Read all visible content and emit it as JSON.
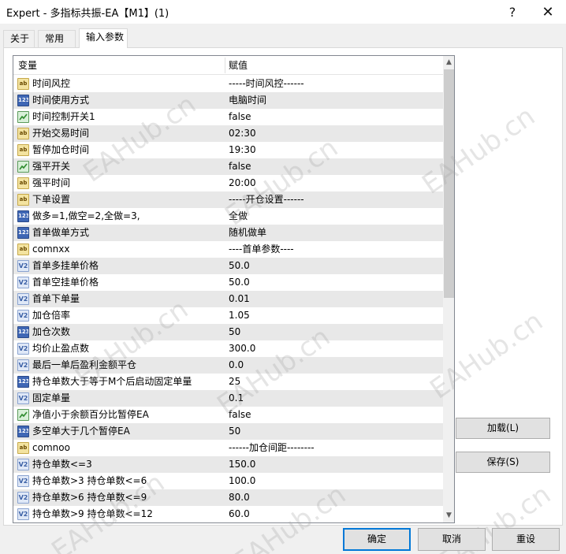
{
  "window": {
    "title": "Expert - 多指标共振-EA【M1】(1)",
    "help_glyph": "?",
    "close_glyph": "✕"
  },
  "tabs": [
    {
      "label": "关于"
    },
    {
      "label": "常用"
    },
    {
      "label": "输入参数",
      "active": true
    }
  ],
  "grid": {
    "col_variable": "变量",
    "col_value": "赋值",
    "rows": [
      {
        "type": "string",
        "name": "时间风控",
        "value": "-----时间风控------"
      },
      {
        "type": "int",
        "name": "时间使用方式",
        "value": "电脑时间"
      },
      {
        "type": "bool",
        "name": "时间控制开关1",
        "value": "false"
      },
      {
        "type": "string",
        "name": "开始交易时间",
        "value": "02:30"
      },
      {
        "type": "string",
        "name": "暂停加仓时间",
        "value": "19:30"
      },
      {
        "type": "bool",
        "name": "强平开关",
        "value": "false"
      },
      {
        "type": "string",
        "name": "强平时间",
        "value": "20:00"
      },
      {
        "type": "string",
        "name": "下单设置",
        "value": "-----开仓设置------"
      },
      {
        "type": "int",
        "name": "做多=1,做空=2,全做=3,",
        "value": "全做"
      },
      {
        "type": "int",
        "name": "首单做单方式",
        "value": "随机做单"
      },
      {
        "type": "string",
        "name": "comnxx",
        "value": "----首单参数----"
      },
      {
        "type": "double",
        "name": "首单多挂单价格",
        "value": "50.0"
      },
      {
        "type": "double",
        "name": "首单空挂单价格",
        "value": "50.0"
      },
      {
        "type": "double",
        "name": "首单下单量",
        "value": "0.01"
      },
      {
        "type": "double",
        "name": "加仓倍率",
        "value": "1.05"
      },
      {
        "type": "int",
        "name": "加仓次数",
        "value": "50"
      },
      {
        "type": "double",
        "name": "均价止盈点数",
        "value": "300.0"
      },
      {
        "type": "double",
        "name": "最后一单后盈利金额平仓",
        "value": "0.0"
      },
      {
        "type": "int",
        "name": "持仓单数大于等于M个后启动固定单量",
        "value": "25"
      },
      {
        "type": "double",
        "name": "固定单量",
        "value": "0.1"
      },
      {
        "type": "bool",
        "name": "净值小于余额百分比暂停EA",
        "value": "false"
      },
      {
        "type": "int",
        "name": "多空单大于几个暂停EA",
        "value": "50"
      },
      {
        "type": "string",
        "name": "comnoo",
        "value": "------加仓间距--------"
      },
      {
        "type": "double",
        "name": "持仓单数<=3",
        "value": "150.0"
      },
      {
        "type": "double",
        "name": "持仓单数>3   持仓单数<=6",
        "value": "100.0"
      },
      {
        "type": "double",
        "name": "持仓单数>6   持仓单数<=9",
        "value": "80.0"
      },
      {
        "type": "double",
        "name": "持仓单数>9   持仓单数<=12",
        "value": "60.0"
      }
    ]
  },
  "icon_glyphs": {
    "string": "ab",
    "int": "123",
    "double": "V2"
  },
  "buttons": {
    "load": "加载(L)",
    "save": "保存(S)",
    "ok": "确定",
    "cancel": "取消",
    "reset": "重设"
  },
  "watermark": "EAHub.cn",
  "scrollbar": {
    "up_glyph": "▲",
    "down_glyph": "▼"
  }
}
